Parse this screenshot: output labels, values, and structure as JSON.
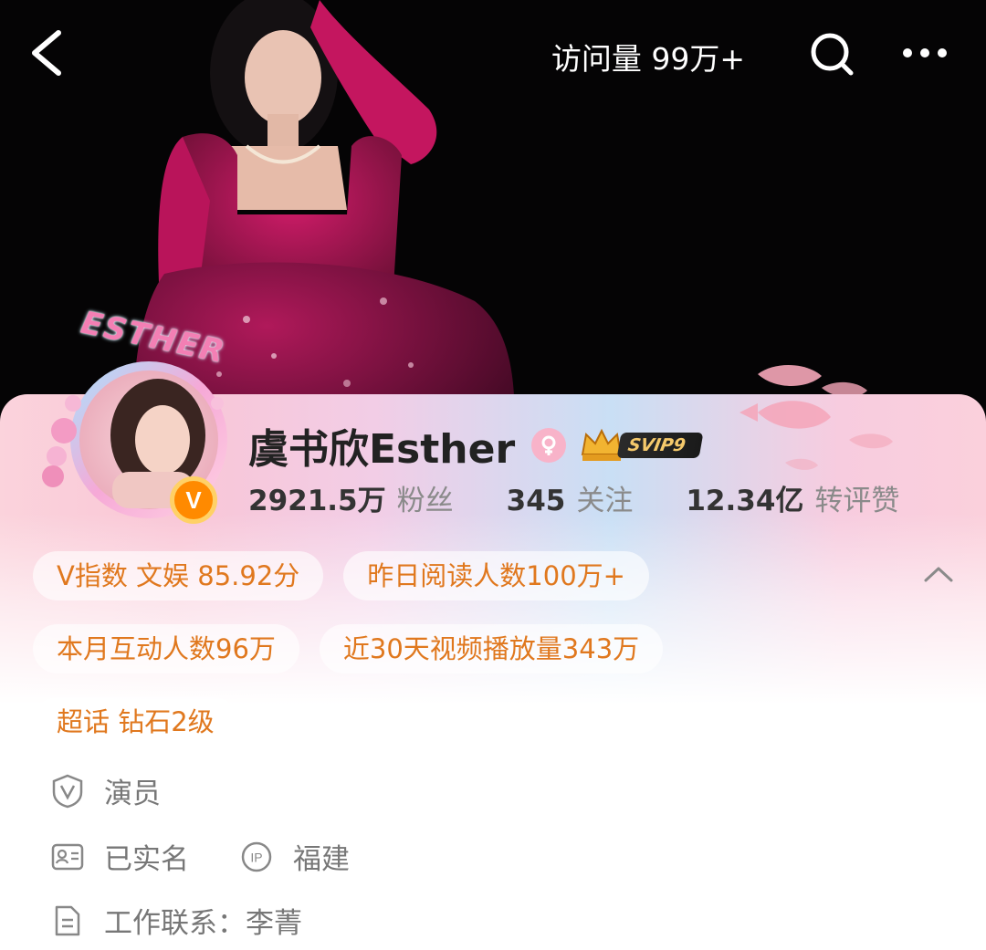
{
  "header": {
    "visits_label": "访问量",
    "visits_value": "99万+",
    "back_icon": "chevron-left-icon",
    "search_icon": "search-icon",
    "more_icon": "more-dots-icon"
  },
  "profile": {
    "avatar_frame_text": "ESTHER",
    "name": "虞书欣Esther",
    "gender": "female",
    "vip_badge": "SVIP9",
    "verified_badge": "V"
  },
  "stats": [
    {
      "value": "2921.5万",
      "label": "粉丝"
    },
    {
      "value": "345",
      "label": "关注"
    },
    {
      "value": "12.34亿",
      "label": "转评赞"
    }
  ],
  "tags": [
    [
      "V指数 文娱 85.92分",
      "昨日阅读人数100万+"
    ],
    [
      "本月互动人数96万",
      "近30天视频播放量343万"
    ],
    [
      "超话 钻石2级"
    ]
  ],
  "info": {
    "occupation": "演员",
    "verified_identity": "已实名",
    "ip_location": "福建",
    "work_contact": "工作联系：李菁"
  },
  "colors": {
    "tag_text": "#e0781e",
    "verified_orange": "#ff8a00",
    "dress_magenta": "#c2155e"
  }
}
